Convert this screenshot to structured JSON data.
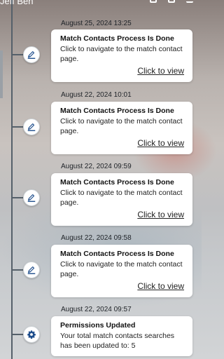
{
  "header": {
    "user_name": "Jeff Ben"
  },
  "notifications": [
    {
      "date": "August 25, 2024 13:25",
      "title": "Match Contacts Process Is Done",
      "body": "Click to navigate to the match contact page.",
      "link": "Click to view",
      "icon": "edit-document-icon"
    },
    {
      "date": "August 22, 2024 10:01",
      "title": "Match Contacts Process Is Done",
      "body": "Click to navigate to the match contact page.",
      "link": "Click to view",
      "icon": "edit-document-icon"
    },
    {
      "date": "August 22, 2024 09:59",
      "title": "Match Contacts Process Is Done",
      "body": "Click to navigate to the match contact page.",
      "link": "Click to view",
      "icon": "edit-document-icon"
    },
    {
      "date": "August 22, 2024 09:58",
      "title": "Match Contacts Process Is Done",
      "body": "Click to navigate to the match contact page.",
      "link": "Click to view",
      "icon": "edit-document-icon"
    },
    {
      "date": "August 22, 2024 09:57",
      "title": "Permissions Updated",
      "body": "Your total match contacts searches has been updated to: 5",
      "link": "",
      "icon": "gear-icon"
    }
  ],
  "colors": {
    "icon_blue": "#1f4e8c",
    "timeline": "#55606a",
    "card_bg": "#ffffff"
  }
}
